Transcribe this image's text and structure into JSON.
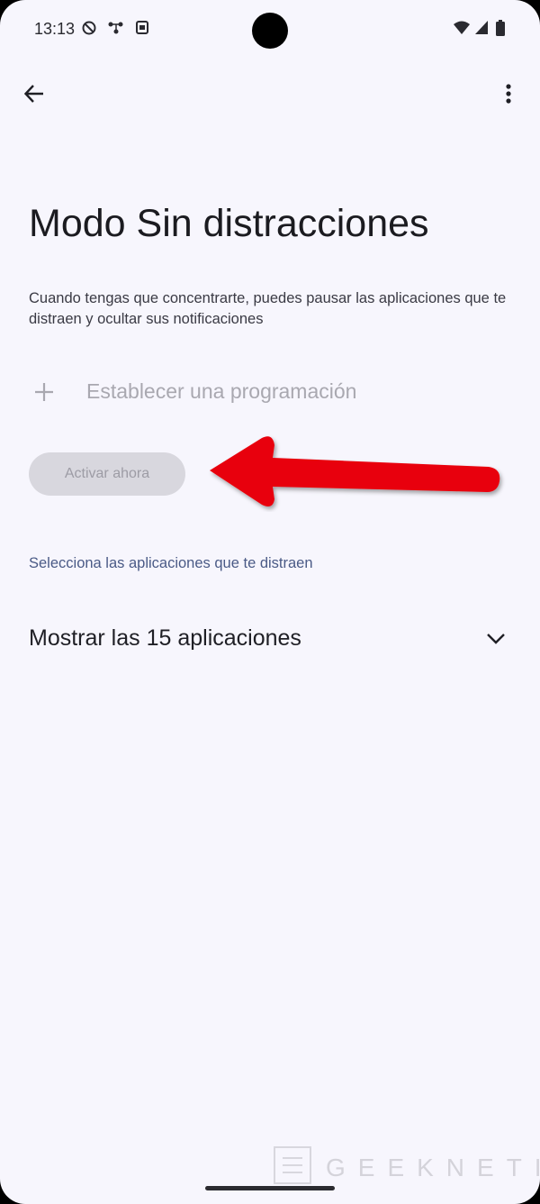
{
  "status_bar": {
    "time": "13:13",
    "left_icons": [
      "do-not-disturb-icon",
      "tethering-icon",
      "notification-icon"
    ],
    "right_icons": [
      "wifi-icon",
      "signal-icon",
      "battery-icon"
    ]
  },
  "top_bar": {
    "back_icon": "arrow-left-icon",
    "menu_icon": "more-vert-icon"
  },
  "page": {
    "title": "Modo Sin distracciones",
    "description": "Cuando tengas que concentrarte, puedes pausar las aplicaciones que te distraen y ocultar sus notificaciones",
    "schedule_label": "Establecer una programación",
    "activate_button": "Activar ahora",
    "select_apps_link": "Selecciona las aplicaciones que te distraen",
    "show_apps_label": "Mostrar las 15 aplicaciones"
  },
  "annotation": {
    "arrow_color": "#e8000b"
  },
  "watermark": {
    "text": "GEEKNETIC"
  },
  "colors": {
    "background": "#f7f6fd",
    "disabled_button": "#d8d7de",
    "link": "#4a5a86"
  }
}
